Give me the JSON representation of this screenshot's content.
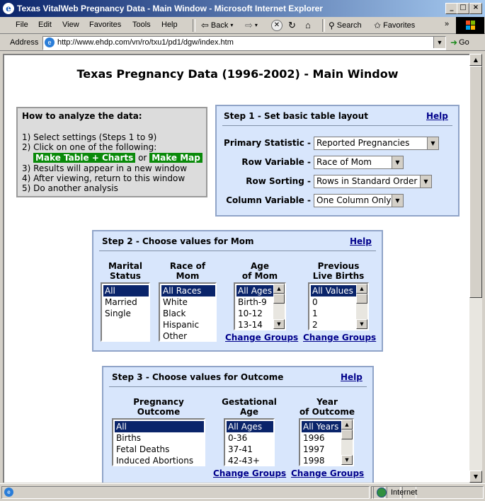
{
  "window": {
    "title": "Texas VitalWeb Pregnancy Data - Main Window - Microsoft Internet Explorer",
    "controls": {
      "minimize": "_",
      "maximize": "□",
      "close": "×"
    }
  },
  "menu": {
    "items": [
      "File",
      "Edit",
      "View",
      "Favorites",
      "Tools",
      "Help"
    ]
  },
  "toolbar": {
    "back": "Back",
    "search": "Search",
    "favorites": "Favorites",
    "chevron": "»"
  },
  "address": {
    "label": "Address",
    "url": "http://www.ehdp.com/vn/ro/txu1/pd1/dgw/index.htm",
    "go": "Go"
  },
  "page": {
    "title": "Texas Pregnancy Data (1996-2002) - Main Window"
  },
  "howto": {
    "heading": "How to analyze the data:",
    "step1": "1) Select settings (Steps 1 to 9)",
    "step2": "2) Click on one of the following:",
    "table_button": "Make Table + Charts",
    "or": "or",
    "map_button": "Make Map",
    "step3": "3) Results will appear in a new window",
    "step4": "4) After viewing, return to this window",
    "step5": "5) Do another analysis"
  },
  "step1": {
    "heading": "Step 1 - Set basic table layout",
    "help": "Help",
    "rows": [
      {
        "label": "Primary Statistic",
        "value": "Reported Pregnancies"
      },
      {
        "label": "Row Variable",
        "value": "Race of Mom"
      },
      {
        "label": "Row Sorting",
        "value": "Rows in Standard Order"
      },
      {
        "label": "Column Variable",
        "value": "One Column Only"
      }
    ]
  },
  "step2": {
    "heading": "Step 2 - Choose values for Mom",
    "help": "Help",
    "marital": {
      "head1": "Marital",
      "head2": "Status",
      "options": [
        "All",
        "Married",
        "Single"
      ]
    },
    "race": {
      "head1": "Race of",
      "head2": "Mom",
      "options": [
        "All Races",
        "White",
        "Black",
        "Hispanic",
        "Other"
      ]
    },
    "age": {
      "head1": "Age",
      "head2": "of Mom",
      "options": [
        "All Ages",
        "Birth-9",
        "10-12",
        "13-14"
      ],
      "change": "Change Groups"
    },
    "births": {
      "head1": "Previous",
      "head2": "Live Births",
      "options": [
        "All Values",
        "0",
        "1",
        "2"
      ],
      "change": "Change Groups"
    }
  },
  "step3": {
    "heading": "Step 3 - Choose values for Outcome",
    "help": "Help",
    "outcome": {
      "head1": "Pregnancy",
      "head2": "Outcome",
      "options": [
        "All",
        "Births",
        "Fetal Deaths",
        "Induced Abortions"
      ]
    },
    "gest": {
      "head1": "Gestational",
      "head2": "Age",
      "options": [
        "All Ages",
        "0-36",
        "37-41",
        "42-43+"
      ],
      "change": "Change Groups"
    },
    "year": {
      "head1": "Year",
      "head2": "of Outcome",
      "options": [
        "All Years",
        "1996",
        "1997",
        "1998"
      ],
      "change": "Change Groups"
    }
  },
  "status": {
    "zone": "Internet"
  }
}
